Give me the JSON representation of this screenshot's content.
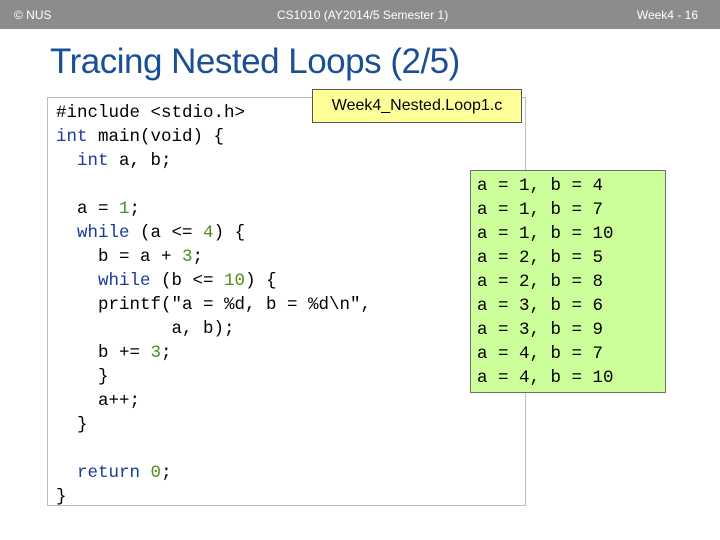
{
  "header": {
    "copyright": "© NUS",
    "course": "CS1010 (AY2014/5 Semester 1)",
    "page": "Week4 - 16"
  },
  "slide": {
    "title": "Tracing Nested Loops (2/5)",
    "file_label": "Week4_Nested.Loop1.c"
  },
  "code": {
    "include": "#include <stdio.h>",
    "main_kw": "int",
    "main_rest": " main(void) {",
    "decl_kw": "int",
    "decl_rest": " a, b;",
    "assign_a": "a = ",
    "assign_a_val": "1",
    "assign_end": ";",
    "while1_kw": "while",
    "while1_cond": " (a <= ",
    "while1_val": "4",
    "while1_end": ") {",
    "b_assign": "b = a + ",
    "b_assign_val": "3",
    "while2_kw": "while",
    "while2_cond": " (b <= ",
    "while2_val": "10",
    "while2_end": ") {",
    "printf_line": "printf(\"a = %d, b = %d\\n\",",
    "printf_args": "a, b);",
    "b_inc": "b += ",
    "b_inc_val": "3",
    "close_inner": "}",
    "a_inc": "a++;",
    "close_outer": "}",
    "return_kw": "return",
    "return_val": "0",
    "close_main": "}"
  },
  "output": {
    "rows": [
      "a = 1, b = 4",
      "a = 1, b = 7",
      "a = 1, b = 10",
      "a = 2, b = 5",
      "a = 2, b = 8",
      "a = 3, b = 6",
      "a = 3, b = 9",
      "a = 4, b = 7",
      "a = 4, b = 10"
    ]
  },
  "colors": {
    "title": "#1a4f96",
    "keyword": "#1a3a9a",
    "number": "#4e8b1c",
    "label_bg": "#ffff99",
    "output_bg": "#ccff99",
    "header_bg": "#8c8c8c"
  }
}
